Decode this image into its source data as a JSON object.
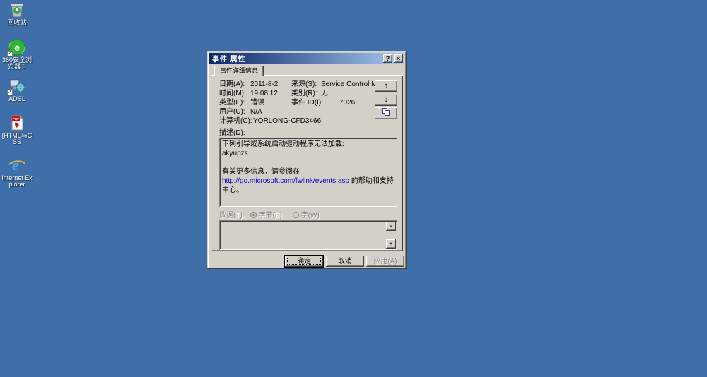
{
  "desktop": {
    "background_color": "#3F6FA8",
    "icons": [
      {
        "name": "recycle-bin",
        "label": "回收站"
      },
      {
        "name": "360-secure-browser",
        "label": "360安全浏览器 3"
      },
      {
        "name": "adsl",
        "label": "ADSL"
      },
      {
        "name": "pdf-document",
        "label": "[HTML与CSS"
      },
      {
        "name": "internet-explorer",
        "label": "Internet Explorer"
      }
    ]
  },
  "dialog": {
    "title": "事件 属性",
    "help_button": "?",
    "close_button": "×",
    "tab_label": "事件详细信息",
    "fields": {
      "date_label": "日期(A):",
      "date_value": "2011-8-2",
      "source_label": "来源(S):",
      "source_value": "Service Control M",
      "time_label": "时间(M):",
      "time_value": "19:08:12",
      "category_label": "类别(R):",
      "category_value": "无",
      "type_label": "类型(E):",
      "type_value": "错误",
      "event_id_label": "事件 ID(I):",
      "event_id_value": "7026",
      "user_label": "用户(U):",
      "user_value": "N/A",
      "computer_label": "计算机(C):",
      "computer_value": "YORLONG-CFD3466"
    },
    "arrows": {
      "up": "↑",
      "down": "↓"
    },
    "description": {
      "label": "描述(D):",
      "line1": "下列引导或系统启动驱动程序无法加载:",
      "line2": "akyupzs",
      "line3": "有关更多信息，请参阅在",
      "link_text": "http://go.microsoft.com/fwlink/events.asp",
      "line4_suffix": " 的帮助和支持中心。"
    },
    "data_section": {
      "label": "数据(T):",
      "radio_bytes_label": "字节(B)",
      "radio_words_label": "字(W)"
    },
    "buttons": {
      "ok": "确定",
      "cancel": "取消",
      "apply": "应用(A)"
    },
    "accent_colors": {
      "titlebar_left": "#0A246A",
      "titlebar_right": "#A6CAF0",
      "link": "#0000CC",
      "chrome": "#D4D0C8"
    }
  }
}
